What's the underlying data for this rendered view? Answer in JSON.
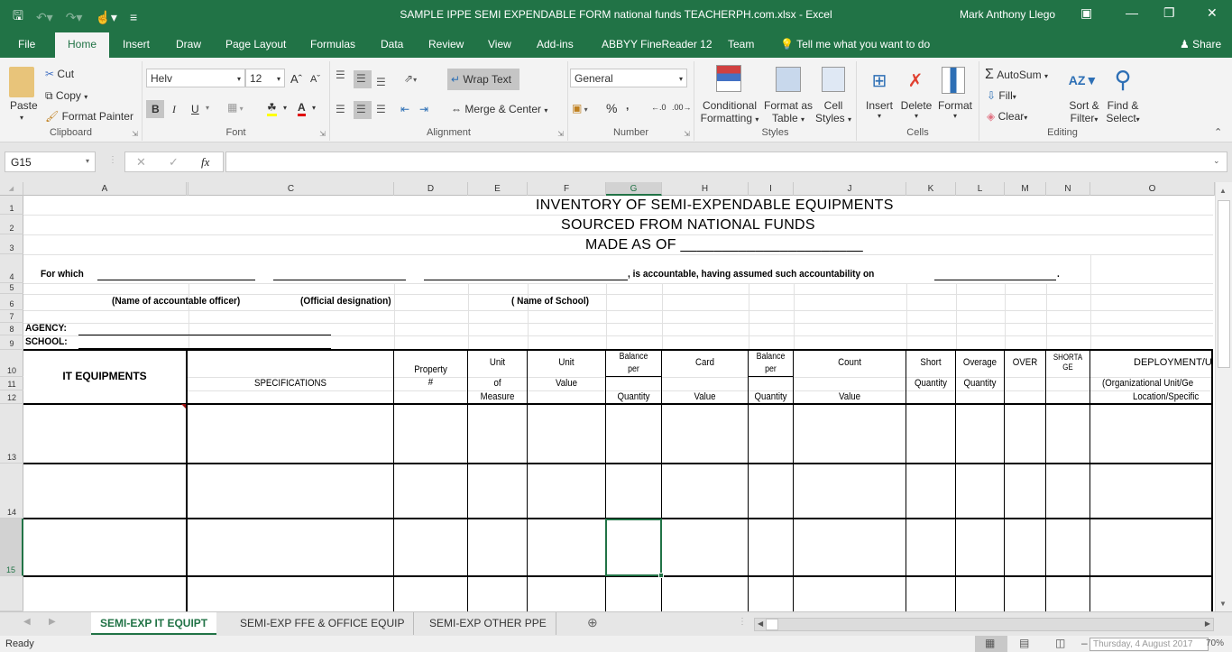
{
  "titlebar": {
    "title": "SAMPLE IPPE SEMI EXPENDABLE FORM national funds  TEACHERPH.com.xlsx - Excel",
    "user": "Mark Anthony Llego",
    "qat_icons": [
      "save-icon",
      "undo-icon",
      "redo-icon",
      "touch-mode-icon",
      "customize-icon"
    ]
  },
  "ribbon_tabs": [
    {
      "label": "File"
    },
    {
      "label": "Home",
      "active": true
    },
    {
      "label": "Insert"
    },
    {
      "label": "Draw"
    },
    {
      "label": "Page Layout"
    },
    {
      "label": "Formulas"
    },
    {
      "label": "Data"
    },
    {
      "label": "Review"
    },
    {
      "label": "View"
    },
    {
      "label": "Add-ins"
    },
    {
      "label": "ABBYY FineReader 12"
    },
    {
      "label": "Team"
    }
  ],
  "tell_me": "Tell me what you want to do",
  "share": "Share",
  "clipboard": {
    "paste": "Paste",
    "cut": "Cut",
    "copy": "Copy",
    "format_painter": "Format Painter",
    "label": "Clipboard"
  },
  "font": {
    "name": "Helv",
    "size": "12",
    "bold": "B",
    "italic": "I",
    "underline": "U",
    "label": "Font"
  },
  "alignment": {
    "wrap_text": "Wrap Text",
    "merge_center": "Merge & Center",
    "label": "Alignment"
  },
  "number": {
    "format": "General",
    "percent": "%",
    "comma": ",",
    "label": "Number"
  },
  "styles": {
    "conditional_1": "Conditional",
    "conditional_2": "Formatting",
    "format_table_1": "Format as",
    "format_table_2": "Table",
    "cell_styles_1": "Cell",
    "cell_styles_2": "Styles",
    "label": "Styles"
  },
  "cells": {
    "insert": "Insert",
    "delete": "Delete",
    "format": "Format",
    "label": "Cells"
  },
  "editing": {
    "autosum": "AutoSum",
    "fill": "Fill",
    "clear": "Clear",
    "sort_1": "Sort &",
    "sort_2": "Filter",
    "find_1": "Find &",
    "find_2": "Select",
    "label": "Editing"
  },
  "formula_bar": {
    "name_box": "G15",
    "formula": "",
    "fx": "fx"
  },
  "columns": [
    "A",
    "C",
    "D",
    "E",
    "F",
    "G",
    "H",
    "I",
    "J",
    "K",
    "L",
    "M",
    "N",
    "O"
  ],
  "selected_column": "G",
  "rows": [
    "1",
    "2",
    "3",
    "4",
    "5",
    "6",
    "7",
    "8",
    "9",
    "10",
    "11",
    "12",
    "13",
    "14",
    "15",
    ""
  ],
  "selected_row": "15",
  "sheet": {
    "title1": "INVENTORY OF SEMI-EXPENDABLE EQUIPMENTS",
    "title2": "SOURCED FROM NATIONAL FUNDS",
    "title3": "MADE AS OF ______________________",
    "for_which": "For which",
    "accountable": ",  is accountable, having assumed such accountability on",
    "period": ".",
    "name_officer": "(Name of accountable officer)",
    "designation": "(Official designation)",
    "name_school": "( Name of School)",
    "agency": "AGENCY:",
    "school": "SCHOOL:",
    "headers": {
      "it_equipments": "IT EQUIPMENTS",
      "specifications": "SPECIFICATIONS",
      "property_1": "Property",
      "property_2": "#",
      "unit_measure_1": "Unit",
      "unit_measure_2": "of",
      "unit_measure_3": "Measure",
      "unit_value_1": "Unit",
      "unit_value_2": "Value",
      "balance_card_1": "Balance",
      "balance_card_2": "per",
      "card": "Card",
      "balance_card_qty": "Quantity",
      "balance_card_val": "Value",
      "balance_count_1": "Balance",
      "balance_count_2": "per",
      "count": "Count",
      "balance_count_qty": "Quantity",
      "balance_count_val": "Value",
      "short_1": "Short",
      "short_2": "Quantity",
      "overage_1": "Overage",
      "overage_2": "Quantity",
      "over": "OVER",
      "shortage_1": "SHORTA",
      "shortage_2": "GE",
      "deployment_1": "DEPLOYMENT/U",
      "deployment_2": "(Organizational Unit/Ge",
      "deployment_3": "Location/Specific"
    }
  },
  "sheet_tabs": [
    {
      "label": "SEMI-EXP IT EQUIPT",
      "active": true
    },
    {
      "label": "SEMI-EXP FFE & OFFICE EQUIP"
    },
    {
      "label": "SEMI-EXP OTHER PPE"
    }
  ],
  "status": {
    "ready": "Ready",
    "date_tooltip": "Thursday, 4 August 2017",
    "zoom": "70%"
  }
}
